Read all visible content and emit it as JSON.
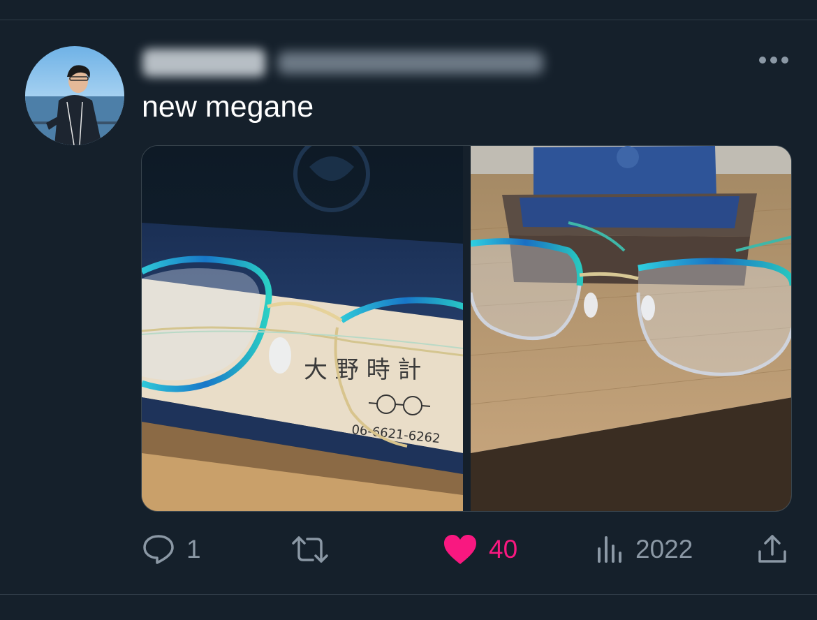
{
  "tweet": {
    "text": "new megane"
  },
  "media": {
    "left_image_label": "大野時計 case",
    "phone_number": "06-6621-6262",
    "shop_brand": "大野時計"
  },
  "actions": {
    "reply_count": "1",
    "retweet_count": "",
    "like_count": "40",
    "views_count": "2022"
  },
  "colors": {
    "background": "#15202b",
    "text": "#ffffff",
    "secondary": "#8b98a5",
    "like": "#f91880",
    "divider": "#2f3b47"
  },
  "icons": {
    "reply": "reply-icon",
    "retweet": "retweet-icon",
    "like": "heart-icon",
    "views": "views-icon",
    "share": "share-icon",
    "more": "more-icon"
  }
}
